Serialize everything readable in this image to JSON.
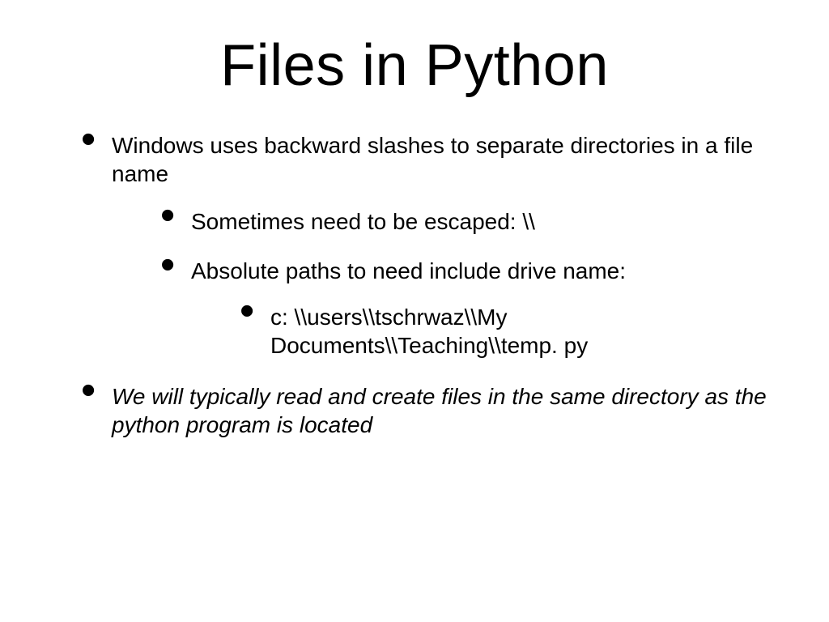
{
  "title": "Files in Python",
  "bullets": {
    "b1": "Windows uses backward slashes to separate directories in a file name",
    "b1a": "Sometimes need to be escaped: \\\\",
    "b1b": "Absolute paths to need include drive name:",
    "b1b1": "c: \\\\users\\\\tschrwaz\\\\My Documents\\\\Teaching\\\\temp. py",
    "b2": "We will typically read and create files in the same directory as the python program is located"
  }
}
